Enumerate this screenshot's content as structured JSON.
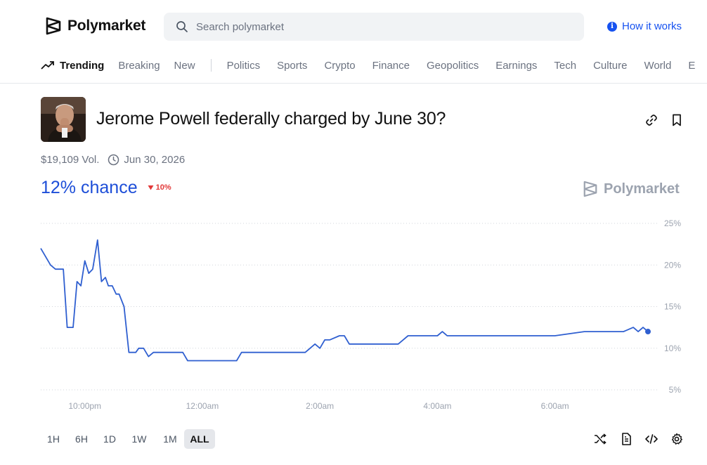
{
  "brand": {
    "name": "Polymarket"
  },
  "search": {
    "placeholder": "Search polymarket"
  },
  "header": {
    "how_it_works": "How it works"
  },
  "nav": {
    "trending": "Trending",
    "items": [
      "Breaking",
      "New"
    ],
    "categories": [
      "Politics",
      "Sports",
      "Crypto",
      "Finance",
      "Geopolitics",
      "Earnings",
      "Tech",
      "Culture",
      "World",
      "E"
    ]
  },
  "market": {
    "title": "Jerome Powell federally charged by June 30?",
    "volume": "$19,109 Vol.",
    "end_date": "Jun 30, 2026",
    "chance": "12% chance",
    "change": "10%",
    "change_direction": "down",
    "watermark": "Polymarket"
  },
  "colors": {
    "accent": "#1652f0",
    "line": "#2f5fd0",
    "negative": "#e23939"
  },
  "timeframes": {
    "options": [
      "1H",
      "6H",
      "1D",
      "1W",
      "1M",
      "ALL"
    ],
    "selected": "ALL"
  },
  "toolbar_icons": [
    "shuffle-icon",
    "document-icon",
    "code-icon",
    "settings-icon"
  ],
  "chart_data": {
    "type": "line",
    "x_ticks": [
      "10:00pm",
      "12:00am",
      "2:00am",
      "4:00am",
      "6:00am"
    ],
    "y_ticks": [
      "25%",
      "20%",
      "15%",
      "10%",
      "5%"
    ],
    "ylim": [
      5,
      25
    ],
    "grid": true,
    "series": [
      {
        "values": [
          22,
          20,
          19.5,
          19.5,
          12.5,
          12.5,
          18,
          17.5,
          20.5,
          19,
          19.5,
          23,
          18,
          18.5,
          17.5,
          17.5,
          16.5,
          16.5,
          15,
          9.5,
          9.5,
          10,
          10,
          9,
          9.5,
          9.5,
          9.5,
          8.5,
          8.5,
          8.5,
          9.5,
          9.5,
          9.5,
          9.5,
          10,
          10.5,
          10,
          11,
          11,
          11.5,
          11.5,
          10.5,
          10.5,
          10.5,
          11,
          11.5,
          11.5,
          11.5,
          12,
          11.5,
          11.5,
          11.5,
          11.5,
          11.5,
          11.5,
          12,
          12,
          12,
          12,
          12.5,
          12,
          12.5,
          12
        ],
        "x": [
          "9:15pm",
          "9:25pm",
          "9:30pm",
          "9:38pm",
          "9:42pm",
          "9:48pm",
          "9:52pm",
          "9:56pm",
          "10:00pm",
          "10:04pm",
          "10:08pm",
          "10:13pm",
          "10:17pm",
          "10:21pm",
          "10:24pm",
          "10:28pm",
          "10:32pm",
          "10:35pm",
          "10:40pm",
          "10:45pm",
          "10:52pm",
          "10:55pm",
          "11:00pm",
          "11:05pm",
          "11:10pm",
          "11:25pm",
          "11:40pm",
          "11:45pm",
          "12:30am",
          "12:35am",
          "12:40am",
          "1:00am",
          "1:30am",
          "1:45am",
          "1:50am",
          "1:55am",
          "2:00am",
          "2:05am",
          "2:10am",
          "2:20am",
          "2:25am",
          "2:30am",
          "3:00am",
          "3:20am",
          "3:25am",
          "3:30am",
          "3:50am",
          "4:00am",
          "4:05am",
          "4:10am",
          "4:15am",
          "4:40am",
          "5:00am",
          "5:40am",
          "6:00am",
          "6:30am",
          "6:50am",
          "7:00am",
          "7:10am",
          "7:20am",
          "7:25am",
          "7:30am",
          "7:35am"
        ]
      }
    ]
  }
}
